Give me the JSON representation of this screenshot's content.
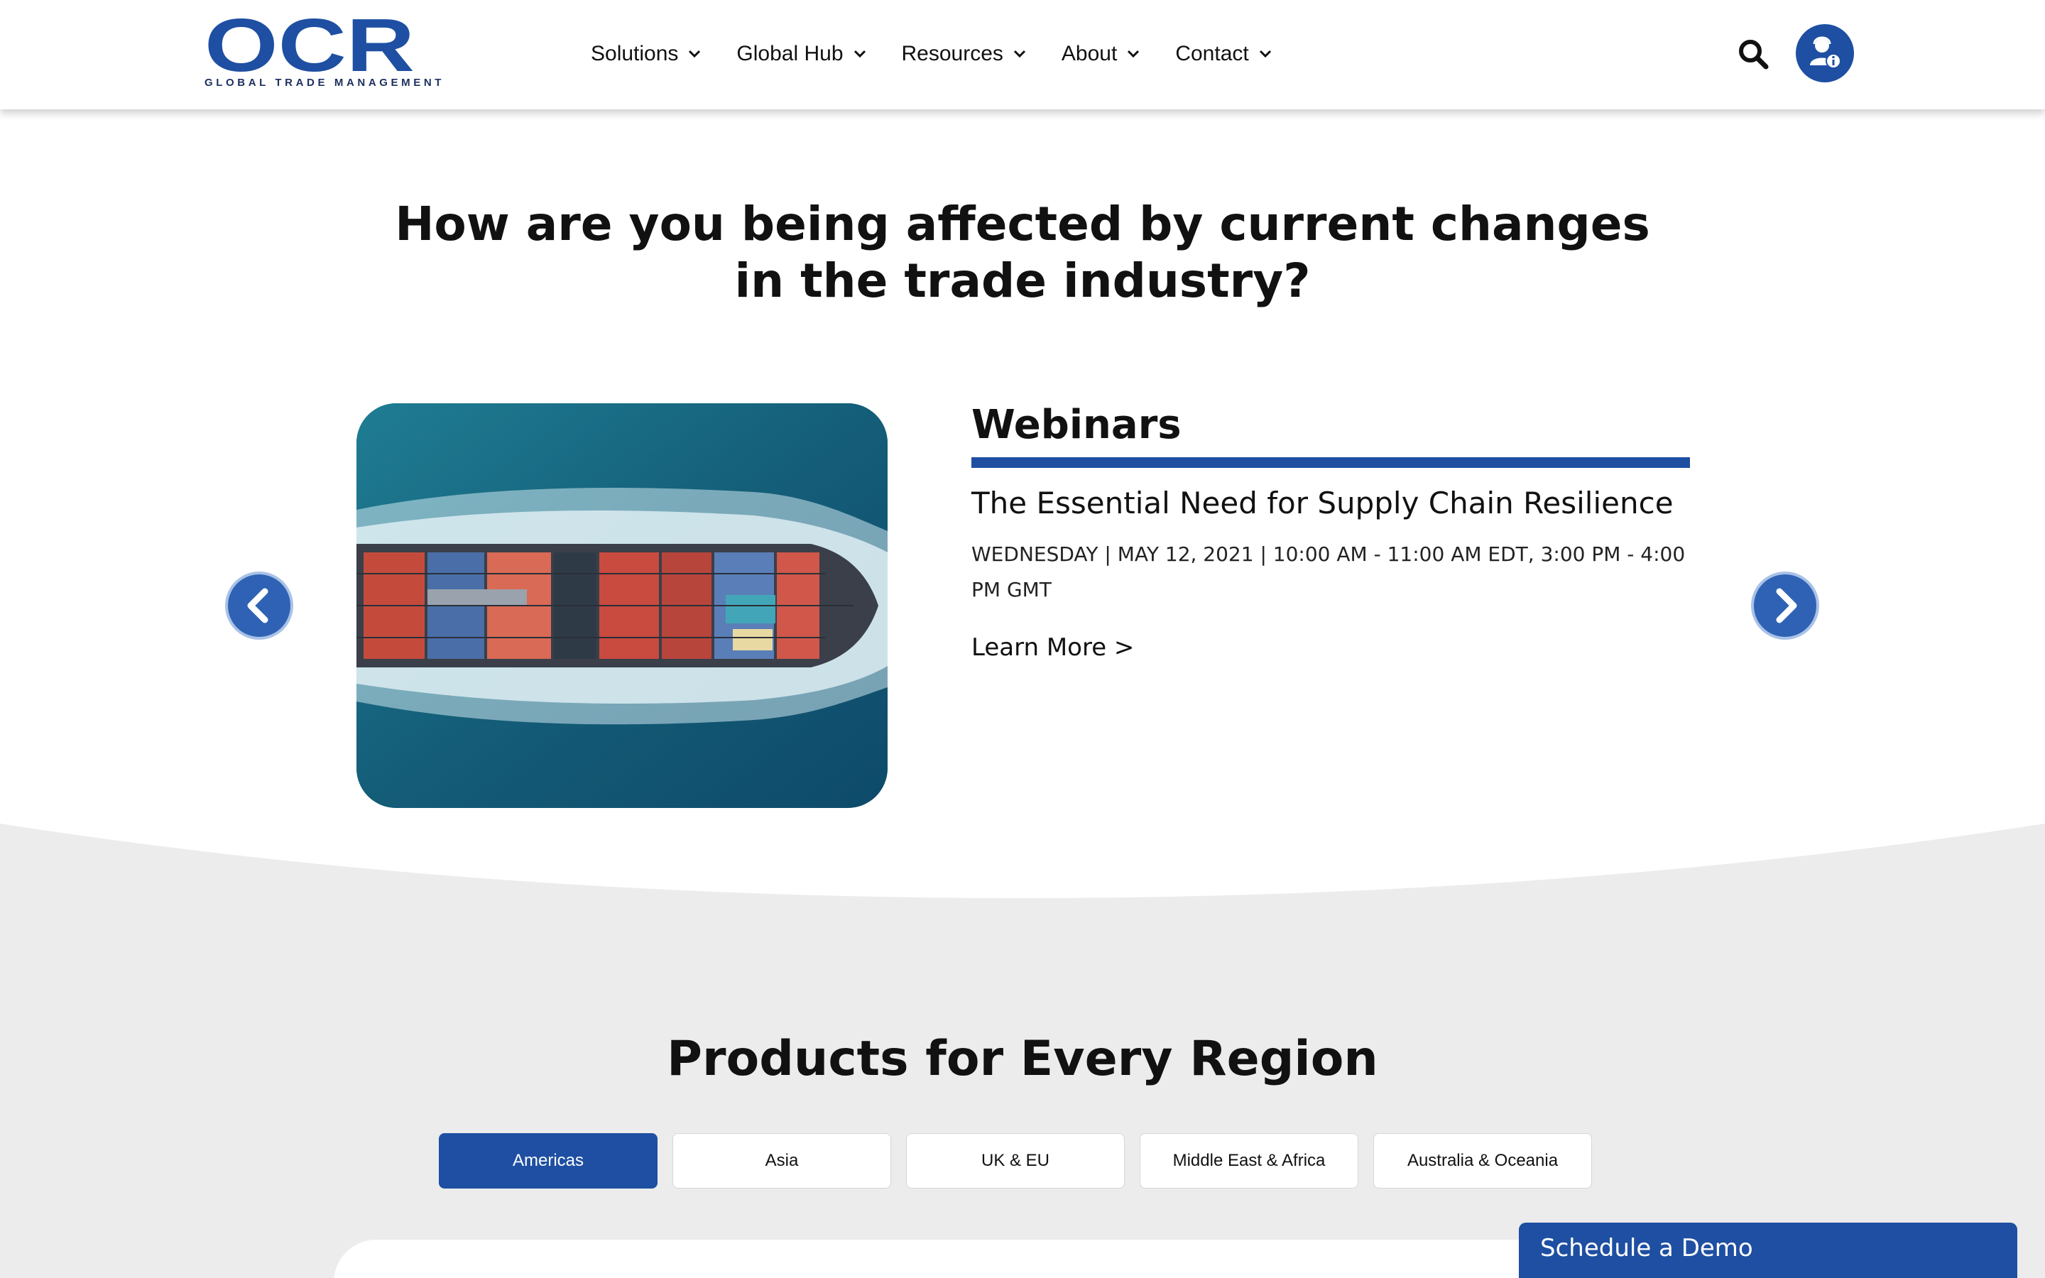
{
  "brand": {
    "logo_text": "OCR",
    "tagline": "GLOBAL TRADE MANAGEMENT",
    "color": "#1e4fa2"
  },
  "nav": {
    "items": [
      {
        "label": "Solutions"
      },
      {
        "label": "Global Hub"
      },
      {
        "label": "Resources"
      },
      {
        "label": "About"
      },
      {
        "label": "Contact"
      }
    ],
    "search_icon": "search-icon",
    "account_icon": "user-info-icon"
  },
  "hero": {
    "title": "How are you being affected by current changes in the trade industry?"
  },
  "carousel": {
    "prev_icon": "chevron-left-icon",
    "next_icon": "chevron-right-icon",
    "slide": {
      "image_subject": "aerial view of container ship at sea",
      "category": "Webinars",
      "headline": "The Essential Need for Supply Chain Resilience",
      "date": "WEDNESDAY | MAY 12, 2021 | 10:00 AM - 11:00 AM EDT, 3:00 PM - 4:00 PM GMT",
      "link": "Learn More >"
    }
  },
  "products": {
    "title": "Products for Every Region",
    "tabs": [
      {
        "label": "Americas",
        "active": true
      },
      {
        "label": "Asia",
        "active": false
      },
      {
        "label": "UK & EU",
        "active": false
      },
      {
        "label": "Middle East & Africa",
        "active": false
      },
      {
        "label": "Australia & Oceania",
        "active": false
      }
    ]
  },
  "cta": {
    "label": "Schedule a Demo"
  },
  "colors": {
    "accent": "#1e4fa2",
    "section_grey": "#ececec"
  }
}
